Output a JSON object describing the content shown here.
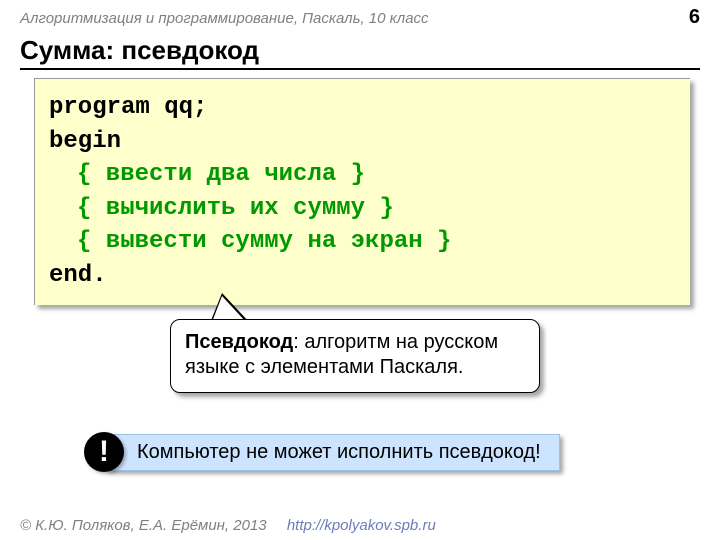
{
  "header": {
    "course": "Алгоритмизация и программирование, Паскаль, 10 класс",
    "page": "6"
  },
  "title": "Сумма: псевдокод",
  "code": {
    "l1": "program qq;",
    "l2": "begin",
    "l3": "{ ввести два числа }",
    "l4": "{ вычислить их сумму }",
    "l5": "{ вывести сумму на экран }",
    "l6": "end."
  },
  "callout": {
    "term": "Псевдокод",
    "rest": ": алгоритм на русском языке с элементами Паскаля."
  },
  "alert": {
    "mark": "!",
    "text": "Компьютер не может исполнить псевдокод!"
  },
  "footer": {
    "copyright": "© К.Ю. Поляков, Е.А. Ерёмин, 2013",
    "link": "http://kpolyakov.spb.ru"
  }
}
